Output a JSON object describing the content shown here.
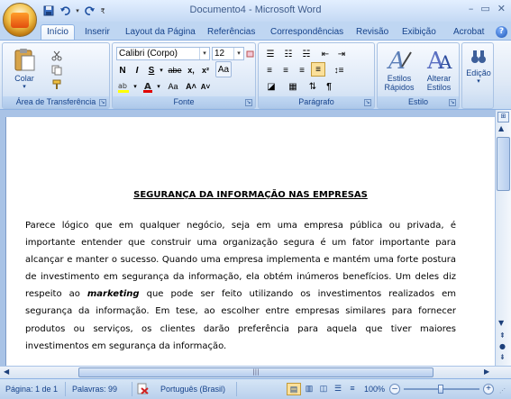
{
  "window": {
    "title": "Documento4 - Microsoft Word",
    "min": "–",
    "max": "▭",
    "close": "✕"
  },
  "qat": {
    "save": "save-icon",
    "undo": "undo-icon",
    "redo": "redo-icon"
  },
  "tabs": [
    "Início",
    "Inserir",
    "Layout da Página",
    "Referências",
    "Correspondências",
    "Revisão",
    "Exibição",
    "Acrobat"
  ],
  "ribbon": {
    "clipboard": {
      "label": "Área de Transferência",
      "paste": "Colar"
    },
    "font": {
      "label": "Fonte",
      "name": "Calibri (Corpo)",
      "size": "12"
    },
    "paragraph": {
      "label": "Parágrafo"
    },
    "styles": {
      "label": "Estilo",
      "quick": "Estilos Rápidos",
      "change": "Alterar Estilos"
    },
    "editing": {
      "label": "Edição"
    }
  },
  "document": {
    "title": "SEGURANÇA DA INFORMAÇÃO NAS EMPRESAS",
    "p1": "Parece lógico que em qualquer negócio, seja em uma empresa pública ou privada, é importante entender que construir uma organização segura é um fator importante para alcançar e manter o sucesso. Quando uma empresa implementa e mantém uma forte postura de investimento em segurança da informação, ela obtém inúmeros benefícios. Um deles diz respeito ao ",
    "p1_em": "marketing",
    "p1_end": " que pode ser feito utilizando os investimentos realizados em segurança da informação. Em tese, ao escolher entre empresas similares para fornecer produtos ou serviços, os clientes darão preferência para aquela que tiver maiores investimentos em segurança da informação."
  },
  "status": {
    "page": "Página: 1 de 1",
    "words": "Palavras: 99",
    "language": "Português (Brasil)",
    "zoom": "100%"
  }
}
